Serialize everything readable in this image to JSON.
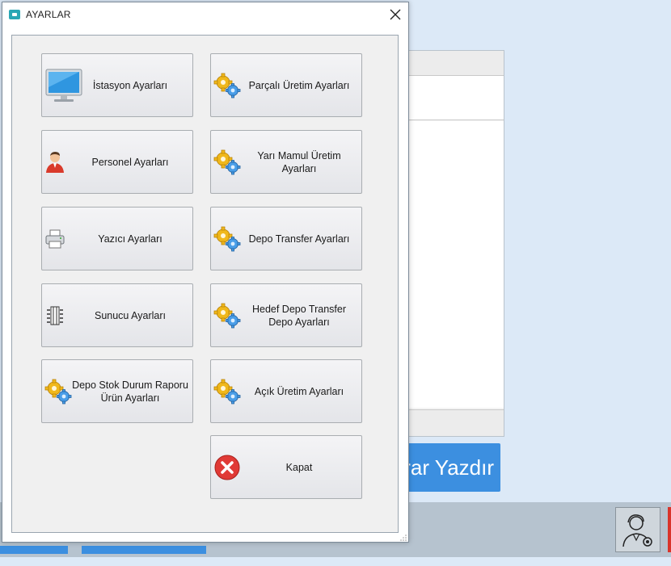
{
  "dialog": {
    "title": "AYARLAR"
  },
  "buttons": {
    "istasyon": "İstasyon Ayarları",
    "personel": "Personel Ayarları",
    "yazici": "Yazıcı Ayarları",
    "sunucu": "Sunucu Ayarları",
    "depo_stok": "Depo Stok Durum Raporu\nÜrün Ayarları",
    "parcali": "Parçalı Üretim Ayarları",
    "yari_mamul": "Yarı Mamul Üretim\nAyarları",
    "depo_transfer": "Depo Transfer Ayarları",
    "hedef_depo": "Hedef Depo Transfer\nDepo Ayarları",
    "acik_uretim": "Açık Üretim Ayarları",
    "kapat": "Kapat"
  },
  "background": {
    "print_button": "trar Yazdır"
  },
  "icons": {
    "istasyon": "monitor-icon",
    "personel": "user-icon",
    "yazici": "printer-icon",
    "sunucu": "server-icon",
    "settings": "gears-icon",
    "kapat": "close-circle-icon"
  },
  "colors": {
    "accent_blue": "#3c8fe0",
    "close_red": "#d9342b"
  }
}
